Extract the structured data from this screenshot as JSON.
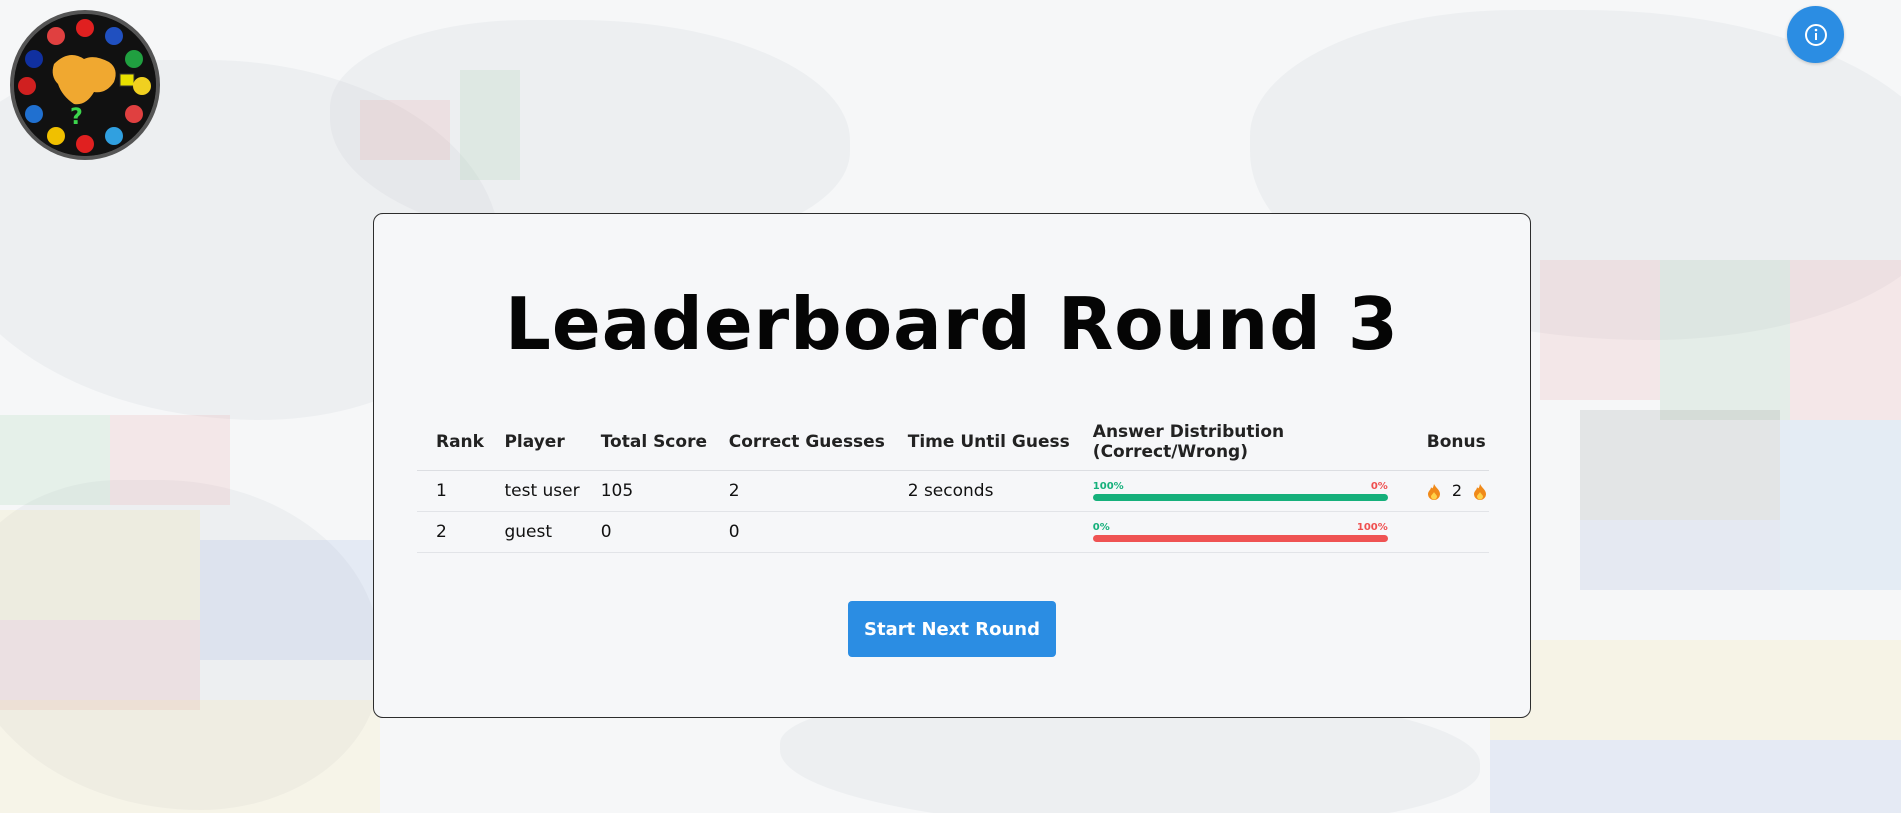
{
  "leaderboard": {
    "title": "Leaderboard Round 3",
    "columns": [
      "Rank",
      "Player",
      "Total Score",
      "Correct Guesses",
      "Time Until Guess",
      "Answer Distribution (Correct/Wrong)",
      "Bonus"
    ],
    "rows": [
      {
        "rank": "1",
        "player": "test user",
        "total_score": "105",
        "correct_guesses": "2",
        "time_until_guess": "2 seconds",
        "correct_pct_label": "100%",
        "wrong_pct_label": "0%",
        "correct_fraction": 1.0,
        "bonus": "2",
        "bonus_icon": "fire-icon"
      },
      {
        "rank": "2",
        "player": "guest",
        "total_score": "0",
        "correct_guesses": "0",
        "time_until_guess": "",
        "correct_pct_label": "0%",
        "wrong_pct_label": "100%",
        "correct_fraction": 0.0,
        "bonus": "",
        "bonus_icon": ""
      }
    ],
    "start_button_label": "Start Next Round"
  },
  "header": {
    "logo_icon": "world-flags-logo",
    "info_icon": "info-icon"
  },
  "colors": {
    "accent": "#2b8de3",
    "correct": "#15b07b",
    "wrong": "#ef5353"
  }
}
